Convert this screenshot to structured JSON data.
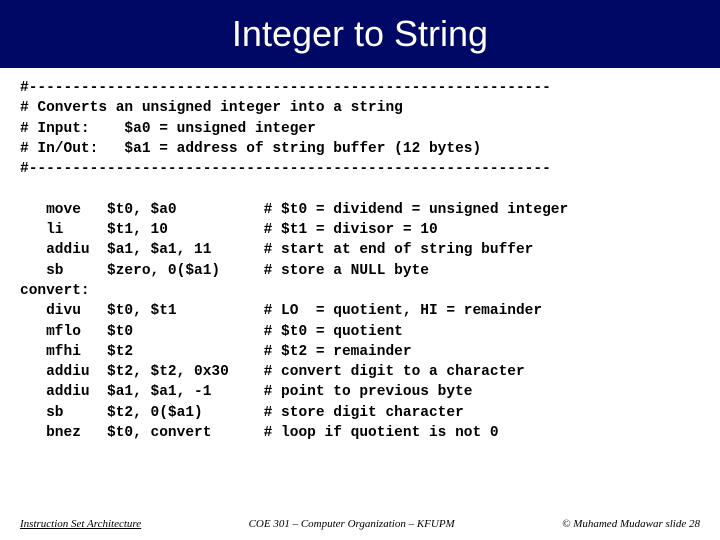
{
  "title": "Integer to String",
  "code": "#------------------------------------------------------------\n# Converts an unsigned integer into a string\n# Input:    $a0 = unsigned integer\n# In/Out:   $a1 = address of string buffer (12 bytes)\n#------------------------------------------------------------\n\n   move   $t0, $a0          # $t0 = dividend = unsigned integer\n   li     $t1, 10           # $t1 = divisor = 10\n   addiu  $a1, $a1, 11      # start at end of string buffer\n   sb     $zero, 0($a1)     # store a NULL byte\nconvert:\n   divu   $t0, $t1          # LO  = quotient, HI = remainder\n   mflo   $t0               # $t0 = quotient\n   mfhi   $t2               # $t2 = remainder\n   addiu  $t2, $t2, 0x30    # convert digit to a character\n   addiu  $a1, $a1, -1      # point to previous byte\n   sb     $t2, 0($a1)       # store digit character\n   bnez   $t0, convert      # loop if quotient is not 0",
  "footer": {
    "left": "Instruction Set Architecture",
    "center": "COE 301 – Computer Organization – KFUPM",
    "right": "© Muhamed Mudawar   slide 28"
  }
}
